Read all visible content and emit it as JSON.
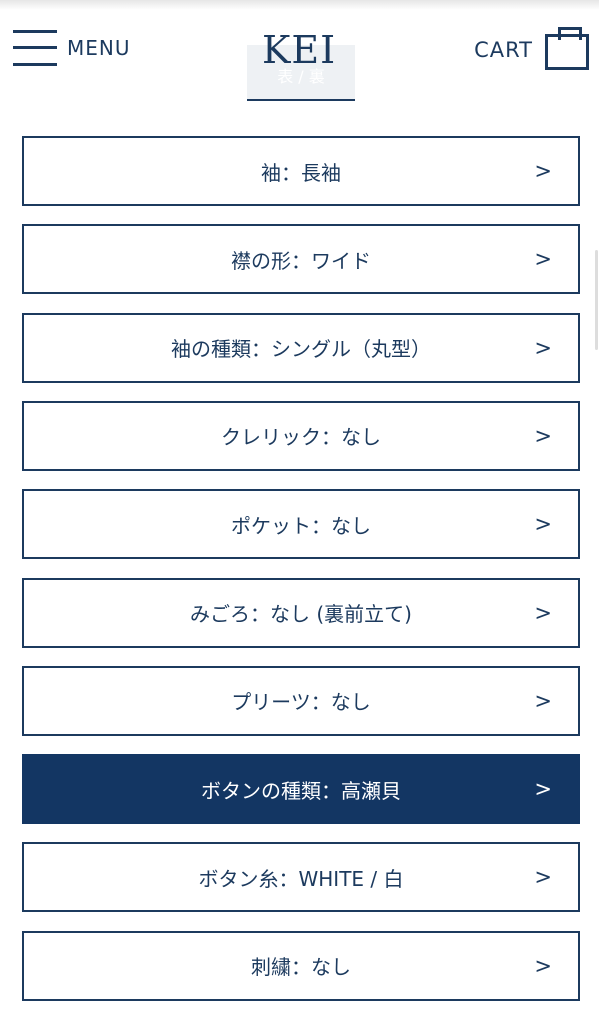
{
  "header": {
    "menu_label": "MENU",
    "logo": "KEI",
    "cart_label": "CART",
    "faded_tab": "表 / 裏"
  },
  "options": [
    {
      "label": "袖：長袖",
      "active": false
    },
    {
      "label": "襟の形：ワイド",
      "active": false
    },
    {
      "label": "袖の種類：シングル（丸型）",
      "active": false
    },
    {
      "label": "クレリック：なし",
      "active": false
    },
    {
      "label": "ポケット：なし",
      "active": false
    },
    {
      "label": "みごろ：なし (裏前立て)",
      "active": false
    },
    {
      "label": "プリーツ：なし",
      "active": false
    },
    {
      "label": "ボタンの種類：高瀬貝",
      "active": true
    },
    {
      "label": "ボタン糸：WHITE / 白",
      "active": false
    },
    {
      "label": "刺繍：なし",
      "active": false
    }
  ],
  "arrow": ">",
  "colors": {
    "navy": "#1c3a5e",
    "active_bg": "#133663"
  }
}
